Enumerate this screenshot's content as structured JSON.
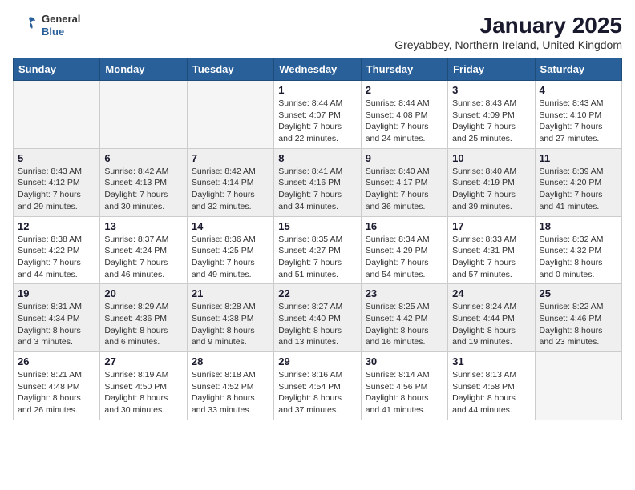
{
  "header": {
    "logo_general": "General",
    "logo_blue": "Blue",
    "month_title": "January 2025",
    "subtitle": "Greyabbey, Northern Ireland, United Kingdom"
  },
  "weekdays": [
    "Sunday",
    "Monday",
    "Tuesday",
    "Wednesday",
    "Thursday",
    "Friday",
    "Saturday"
  ],
  "weeks": [
    [
      {
        "day": "",
        "info": ""
      },
      {
        "day": "",
        "info": ""
      },
      {
        "day": "",
        "info": ""
      },
      {
        "day": "1",
        "info": "Sunrise: 8:44 AM\nSunset: 4:07 PM\nDaylight: 7 hours\nand 22 minutes."
      },
      {
        "day": "2",
        "info": "Sunrise: 8:44 AM\nSunset: 4:08 PM\nDaylight: 7 hours\nand 24 minutes."
      },
      {
        "day": "3",
        "info": "Sunrise: 8:43 AM\nSunset: 4:09 PM\nDaylight: 7 hours\nand 25 minutes."
      },
      {
        "day": "4",
        "info": "Sunrise: 8:43 AM\nSunset: 4:10 PM\nDaylight: 7 hours\nand 27 minutes."
      }
    ],
    [
      {
        "day": "5",
        "info": "Sunrise: 8:43 AM\nSunset: 4:12 PM\nDaylight: 7 hours\nand 29 minutes."
      },
      {
        "day": "6",
        "info": "Sunrise: 8:42 AM\nSunset: 4:13 PM\nDaylight: 7 hours\nand 30 minutes."
      },
      {
        "day": "7",
        "info": "Sunrise: 8:42 AM\nSunset: 4:14 PM\nDaylight: 7 hours\nand 32 minutes."
      },
      {
        "day": "8",
        "info": "Sunrise: 8:41 AM\nSunset: 4:16 PM\nDaylight: 7 hours\nand 34 minutes."
      },
      {
        "day": "9",
        "info": "Sunrise: 8:40 AM\nSunset: 4:17 PM\nDaylight: 7 hours\nand 36 minutes."
      },
      {
        "day": "10",
        "info": "Sunrise: 8:40 AM\nSunset: 4:19 PM\nDaylight: 7 hours\nand 39 minutes."
      },
      {
        "day": "11",
        "info": "Sunrise: 8:39 AM\nSunset: 4:20 PM\nDaylight: 7 hours\nand 41 minutes."
      }
    ],
    [
      {
        "day": "12",
        "info": "Sunrise: 8:38 AM\nSunset: 4:22 PM\nDaylight: 7 hours\nand 44 minutes."
      },
      {
        "day": "13",
        "info": "Sunrise: 8:37 AM\nSunset: 4:24 PM\nDaylight: 7 hours\nand 46 minutes."
      },
      {
        "day": "14",
        "info": "Sunrise: 8:36 AM\nSunset: 4:25 PM\nDaylight: 7 hours\nand 49 minutes."
      },
      {
        "day": "15",
        "info": "Sunrise: 8:35 AM\nSunset: 4:27 PM\nDaylight: 7 hours\nand 51 minutes."
      },
      {
        "day": "16",
        "info": "Sunrise: 8:34 AM\nSunset: 4:29 PM\nDaylight: 7 hours\nand 54 minutes."
      },
      {
        "day": "17",
        "info": "Sunrise: 8:33 AM\nSunset: 4:31 PM\nDaylight: 7 hours\nand 57 minutes."
      },
      {
        "day": "18",
        "info": "Sunrise: 8:32 AM\nSunset: 4:32 PM\nDaylight: 8 hours\nand 0 minutes."
      }
    ],
    [
      {
        "day": "19",
        "info": "Sunrise: 8:31 AM\nSunset: 4:34 PM\nDaylight: 8 hours\nand 3 minutes."
      },
      {
        "day": "20",
        "info": "Sunrise: 8:29 AM\nSunset: 4:36 PM\nDaylight: 8 hours\nand 6 minutes."
      },
      {
        "day": "21",
        "info": "Sunrise: 8:28 AM\nSunset: 4:38 PM\nDaylight: 8 hours\nand 9 minutes."
      },
      {
        "day": "22",
        "info": "Sunrise: 8:27 AM\nSunset: 4:40 PM\nDaylight: 8 hours\nand 13 minutes."
      },
      {
        "day": "23",
        "info": "Sunrise: 8:25 AM\nSunset: 4:42 PM\nDaylight: 8 hours\nand 16 minutes."
      },
      {
        "day": "24",
        "info": "Sunrise: 8:24 AM\nSunset: 4:44 PM\nDaylight: 8 hours\nand 19 minutes."
      },
      {
        "day": "25",
        "info": "Sunrise: 8:22 AM\nSunset: 4:46 PM\nDaylight: 8 hours\nand 23 minutes."
      }
    ],
    [
      {
        "day": "26",
        "info": "Sunrise: 8:21 AM\nSunset: 4:48 PM\nDaylight: 8 hours\nand 26 minutes."
      },
      {
        "day": "27",
        "info": "Sunrise: 8:19 AM\nSunset: 4:50 PM\nDaylight: 8 hours\nand 30 minutes."
      },
      {
        "day": "28",
        "info": "Sunrise: 8:18 AM\nSunset: 4:52 PM\nDaylight: 8 hours\nand 33 minutes."
      },
      {
        "day": "29",
        "info": "Sunrise: 8:16 AM\nSunset: 4:54 PM\nDaylight: 8 hours\nand 37 minutes."
      },
      {
        "day": "30",
        "info": "Sunrise: 8:14 AM\nSunset: 4:56 PM\nDaylight: 8 hours\nand 41 minutes."
      },
      {
        "day": "31",
        "info": "Sunrise: 8:13 AM\nSunset: 4:58 PM\nDaylight: 8 hours\nand 44 minutes."
      },
      {
        "day": "",
        "info": ""
      }
    ]
  ]
}
